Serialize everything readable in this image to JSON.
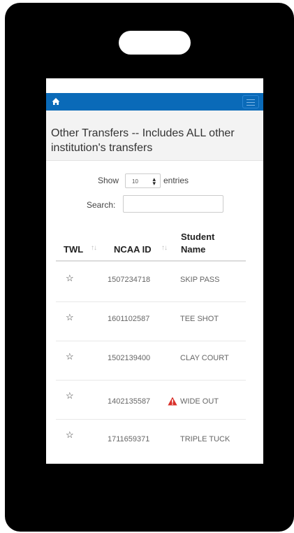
{
  "header": {
    "home_icon": "home-icon",
    "menu_icon": "hamburger-menu-icon",
    "bar_color": "#0a6ab8"
  },
  "panel": {
    "title": "Other Transfers -- Includes ALL other institution's transfers"
  },
  "controls": {
    "show_label": "Show",
    "entries_value": "10",
    "entries_label": "entries",
    "search_label": "Search:",
    "search_value": ""
  },
  "table": {
    "columns": [
      "TWL",
      "NCAA ID",
      "Student Name"
    ],
    "rows": [
      {
        "twl_icon": "star-outline-icon",
        "ncaa_id": "1507234718",
        "name": "SKIP PASS",
        "warning": false
      },
      {
        "twl_icon": "star-outline-icon",
        "ncaa_id": "1601102587",
        "name": "TEE SHOT",
        "warning": false
      },
      {
        "twl_icon": "star-outline-icon",
        "ncaa_id": "1502139400",
        "name": "CLAY COURT",
        "warning": false
      },
      {
        "twl_icon": "star-outline-icon",
        "ncaa_id": "1402135587",
        "name": "WIDE OUT",
        "warning": true
      },
      {
        "twl_icon": "star-outline-icon",
        "ncaa_id": "1711659371",
        "name": "TRIPLE TUCK",
        "warning": false
      }
    ]
  },
  "colors": {
    "warning": "#d9302a"
  }
}
